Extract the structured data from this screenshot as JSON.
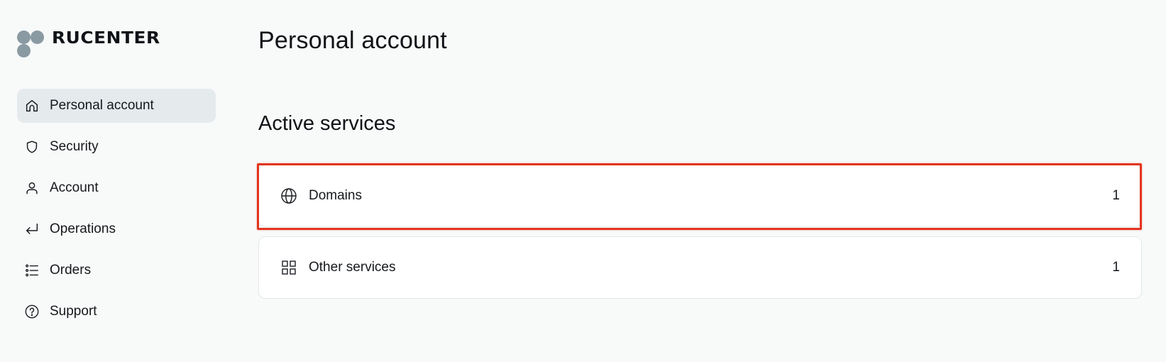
{
  "brand": {
    "name": "RUCENTER",
    "logo_color": "#8a9aa3"
  },
  "sidebar": {
    "items": [
      {
        "label": "Personal account",
        "icon": "home-icon",
        "active": true
      },
      {
        "label": "Security",
        "icon": "shield-icon",
        "active": false
      },
      {
        "label": "Account",
        "icon": "user-icon",
        "active": false
      },
      {
        "label": "Operations",
        "icon": "enter-arrow-icon",
        "active": false
      },
      {
        "label": "Orders",
        "icon": "list-icon",
        "active": false
      },
      {
        "label": "Support",
        "icon": "help-circle-icon",
        "active": false
      }
    ]
  },
  "main": {
    "title": "Personal account",
    "section_title": "Active services",
    "services": [
      {
        "label": "Domains",
        "count": "1",
        "icon": "globe-icon",
        "highlighted": true
      },
      {
        "label": "Other services",
        "count": "1",
        "icon": "grid-icon",
        "highlighted": false
      }
    ]
  },
  "colors": {
    "highlight": "#e3341f",
    "active_nav_bg": "#e5eaed",
    "page_bg": "#f8f9f9"
  }
}
